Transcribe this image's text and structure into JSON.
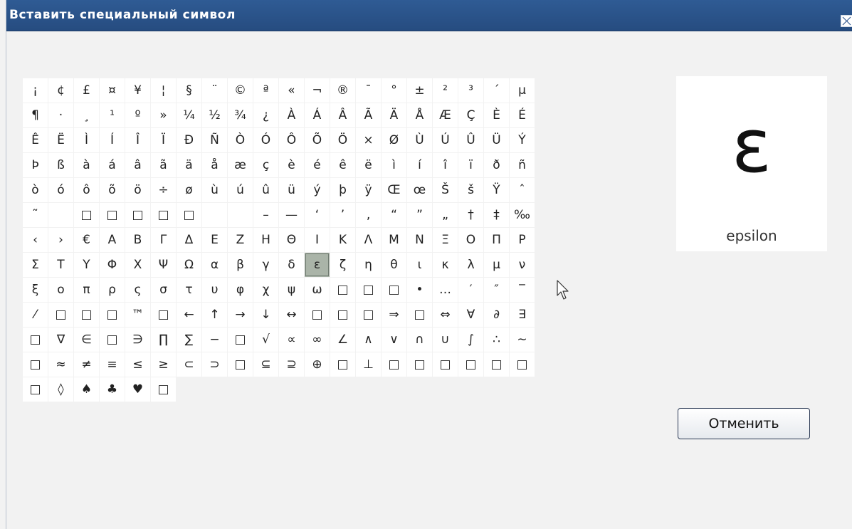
{
  "dialog": {
    "title": "Вставить специальный символ",
    "close_icon": "close-icon",
    "cancel_label": "Отменить",
    "accent_color": "#2f5b94"
  },
  "preview": {
    "char": "ε",
    "name": "epsilon"
  },
  "selected_symbol": "ε",
  "symbols": [
    [
      "¡",
      "¢",
      "£",
      "¤",
      "¥",
      "¦",
      "§",
      "¨",
      "©",
      "ª",
      "«",
      "¬",
      "®",
      "¯",
      "°",
      "±",
      "²",
      "³",
      "´"
    ],
    [
      "µ",
      "¶",
      "·",
      "¸",
      "¹",
      "º",
      "»",
      "¼",
      "½",
      "¾",
      "¿",
      "À",
      "Á",
      "Â",
      "Ã",
      "Ä",
      "Å",
      "Æ",
      "Ç"
    ],
    [
      "È",
      "É",
      "Ê",
      "Ë",
      "Ì",
      "Í",
      "Î",
      "Ï",
      "Ð",
      "Ñ",
      "Ò",
      "Ó",
      "Ô",
      "Õ",
      "Ö",
      "×",
      "Ø",
      "Ù",
      "Ú"
    ],
    [
      "Û",
      "Ü",
      "Ý",
      "Þ",
      "ß",
      "à",
      "á",
      "â",
      "ã",
      "ä",
      "å",
      "æ",
      "ç",
      "è",
      "é",
      "ê",
      "ë",
      "ì",
      "í"
    ],
    [
      "î",
      "ï",
      "ð",
      "ñ",
      "ò",
      "ó",
      "ô",
      "õ",
      "ö",
      "÷",
      "ø",
      "ù",
      "ú",
      "û",
      "ü",
      "ý",
      "þ",
      "ÿ",
      "Œ"
    ],
    [
      "œ",
      "Š",
      "š",
      "Ÿ",
      "ˆ",
      "˜",
      "",
      "□",
      "□",
      "□",
      "□",
      "□",
      "",
      "",
      "–",
      "—",
      "‘",
      "’",
      "‚",
      "“"
    ],
    [
      "”",
      "„",
      "†",
      "‡",
      "‰",
      "‹",
      "›",
      "€",
      "Α",
      "Β",
      "Γ",
      "Δ",
      "Ε",
      "Ζ",
      "Η",
      "Θ",
      "Ι",
      "Κ",
      "Λ"
    ],
    [
      "Μ",
      "Ν",
      "Ξ",
      "Ο",
      "Π",
      "Ρ",
      "Σ",
      "Τ",
      "Υ",
      "Φ",
      "Χ",
      "Ψ",
      "Ω",
      "α",
      "β",
      "γ",
      "δ",
      "ε",
      "ζ"
    ],
    [
      "η",
      "θ",
      "ι",
      "κ",
      "λ",
      "μ",
      "ν",
      "ξ",
      "ο",
      "π",
      "ρ",
      "ς",
      "σ",
      "τ",
      "υ",
      "φ",
      "χ",
      "ψ",
      "ω"
    ],
    [
      "□",
      "□",
      "□",
      "•",
      "…",
      "′",
      "″",
      "‾",
      "⁄",
      "□",
      "□",
      "□",
      "™",
      "□",
      "←",
      "↑",
      "→",
      "↓",
      "↔"
    ],
    [
      "□",
      "□",
      "□",
      "⇒",
      "□",
      "⇔",
      "∀",
      "∂",
      "∃",
      "□",
      "∇",
      "∈",
      "□",
      "∋",
      "∏",
      "∑",
      "−",
      "□",
      "√"
    ],
    [
      "∝",
      "∞",
      "∠",
      "∧",
      "∨",
      "∩",
      "∪",
      "∫",
      "∴",
      "∼",
      "□",
      "≈",
      "≠",
      "≡",
      "≤",
      "≥",
      "⊂",
      "⊃",
      "□"
    ],
    [
      "⊆",
      "⊇",
      "⊕",
      "□",
      "⊥",
      "□",
      "□",
      "□",
      "□",
      "□",
      "□",
      "□",
      "◊",
      "♠",
      "♣",
      "♥",
      "□"
    ]
  ]
}
